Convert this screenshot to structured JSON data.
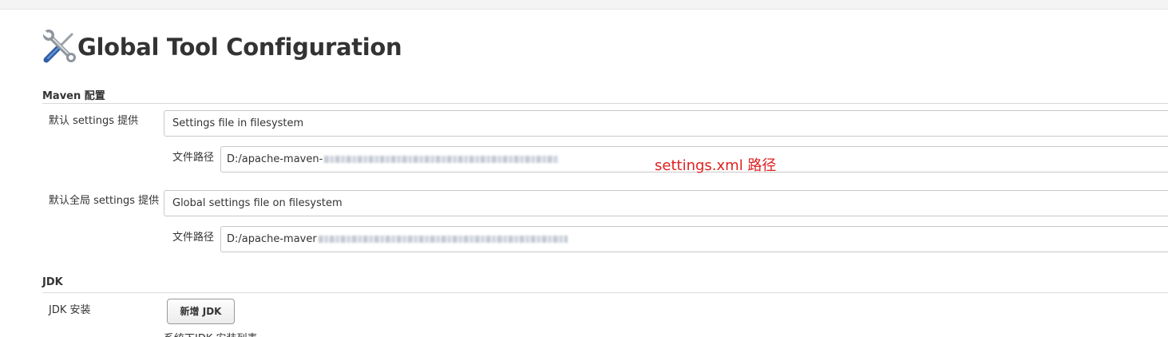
{
  "header": {
    "title": "Global Tool Configuration",
    "icon": "tools-icon"
  },
  "maven": {
    "section_title": "Maven 配置",
    "settings_label": "默认 settings 提供",
    "settings_value": "Settings file in filesystem",
    "settings_path_label": "文件路径",
    "settings_path_value": "D:/apache-maven-",
    "global_label": "默认全局 settings 提供",
    "global_value": "Global settings file on filesystem",
    "global_path_label": "文件路径",
    "global_path_value": "D:/apache-maver"
  },
  "annotation": {
    "text": "settings.xml 路径",
    "color": "#e02020"
  },
  "jdk": {
    "section_title": "JDK",
    "install_label": "JDK 安装",
    "add_button": "新增 JDK",
    "list_hint": "系统下JDK 安装列表"
  }
}
